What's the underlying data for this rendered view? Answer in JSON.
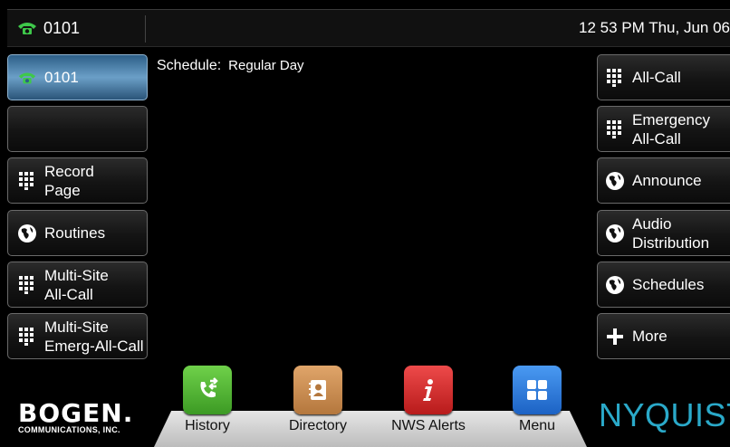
{
  "topbar": {
    "extension": "0101",
    "datetime": "12 53 PM Thu, Jun 06"
  },
  "schedule": {
    "label": "Schedule:",
    "value": "Regular Day"
  },
  "left_buttons": [
    {
      "line1": "0101",
      "line2": "",
      "icon": "phone-icon",
      "active": true
    },
    {
      "line1": "",
      "line2": "",
      "icon": "",
      "active": false
    },
    {
      "line1": "Record",
      "line2": "Page",
      "icon": "keypad-icon"
    },
    {
      "line1": "Routines",
      "line2": "",
      "icon": "globe-icon"
    },
    {
      "line1": "Multi-Site",
      "line2": "All-Call",
      "icon": "keypad-icon"
    },
    {
      "line1": "Multi-Site",
      "line2": "Emerg-All-Call",
      "icon": "keypad-icon"
    }
  ],
  "right_buttons": [
    {
      "line1": "All-Call",
      "line2": "",
      "icon": "keypad-icon"
    },
    {
      "line1": "Emergency",
      "line2": "All-Call",
      "icon": "keypad-icon"
    },
    {
      "line1": "Announce",
      "line2": "",
      "icon": "globe-icon"
    },
    {
      "line1": "Audio",
      "line2": "Distribution",
      "icon": "globe-icon"
    },
    {
      "line1": "Schedules",
      "line2": "",
      "icon": "globe-icon"
    },
    {
      "line1": "More",
      "line2": "",
      "icon": "plus-icon"
    }
  ],
  "dock": [
    {
      "label": "History",
      "icon": "call-history-icon",
      "color": "#4caf2f"
    },
    {
      "label": "Directory",
      "icon": "address-book-icon",
      "color": "#c98a4b"
    },
    {
      "label": "NWS Alerts",
      "icon": "info-icon",
      "color": "#d52b2b"
    },
    {
      "label": "Menu",
      "icon": "grid-menu-icon",
      "color": "#2f7fe0"
    }
  ],
  "logos": {
    "bogen": "BOGEN.",
    "bogen_sub": "COMMUNICATIONS, INC.",
    "nyquist": "NYQUIST"
  },
  "colors": {
    "accent": "#2aa9c9",
    "phone_green": "#3ec84a",
    "active_button": "#4a86b6"
  }
}
